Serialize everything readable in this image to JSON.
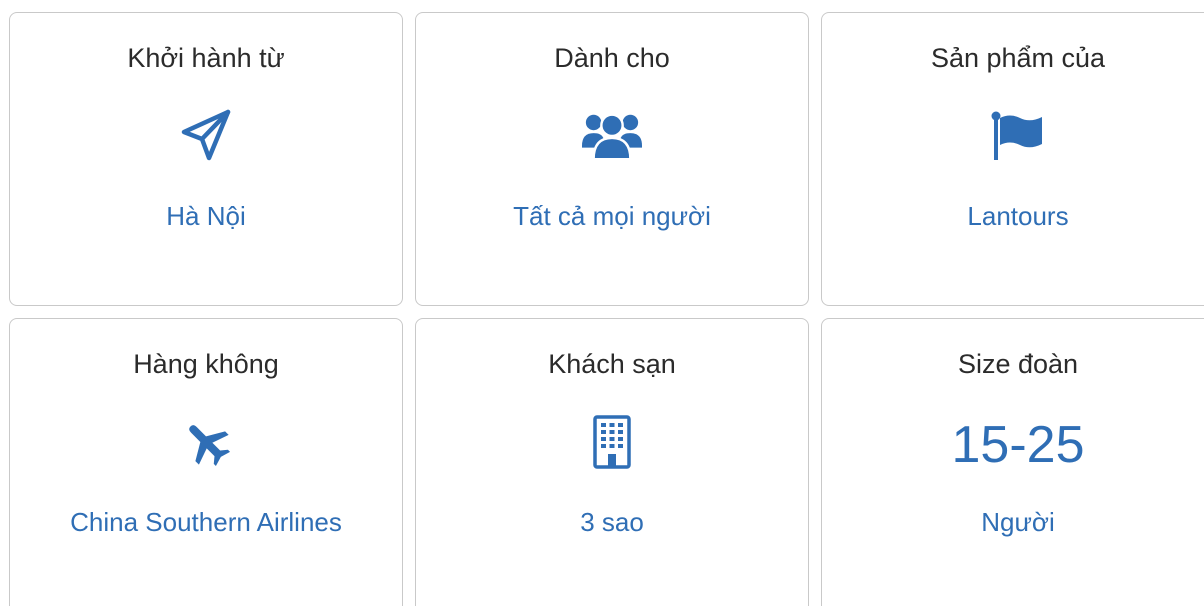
{
  "colors": {
    "accent": "#2f6eb5",
    "border": "#c9c9c9",
    "title_text": "#2b2b2b"
  },
  "cards": [
    {
      "title": "Khởi hành từ",
      "icon": "paper-plane-icon",
      "value": "Hà Nội"
    },
    {
      "title": "Dành cho",
      "icon": "users-group-icon",
      "value": "Tất cả mọi người"
    },
    {
      "title": "Sản phẩm của",
      "icon": "flag-icon",
      "value": "Lantours"
    },
    {
      "title": "Hàng không",
      "icon": "airplane-icon",
      "value": "China Southern Airlines"
    },
    {
      "title": "Khách sạn",
      "icon": "hotel-building-icon",
      "value": "3 sao"
    },
    {
      "title": "Size đoàn",
      "big_value": "15-25",
      "value": "Người"
    }
  ]
}
